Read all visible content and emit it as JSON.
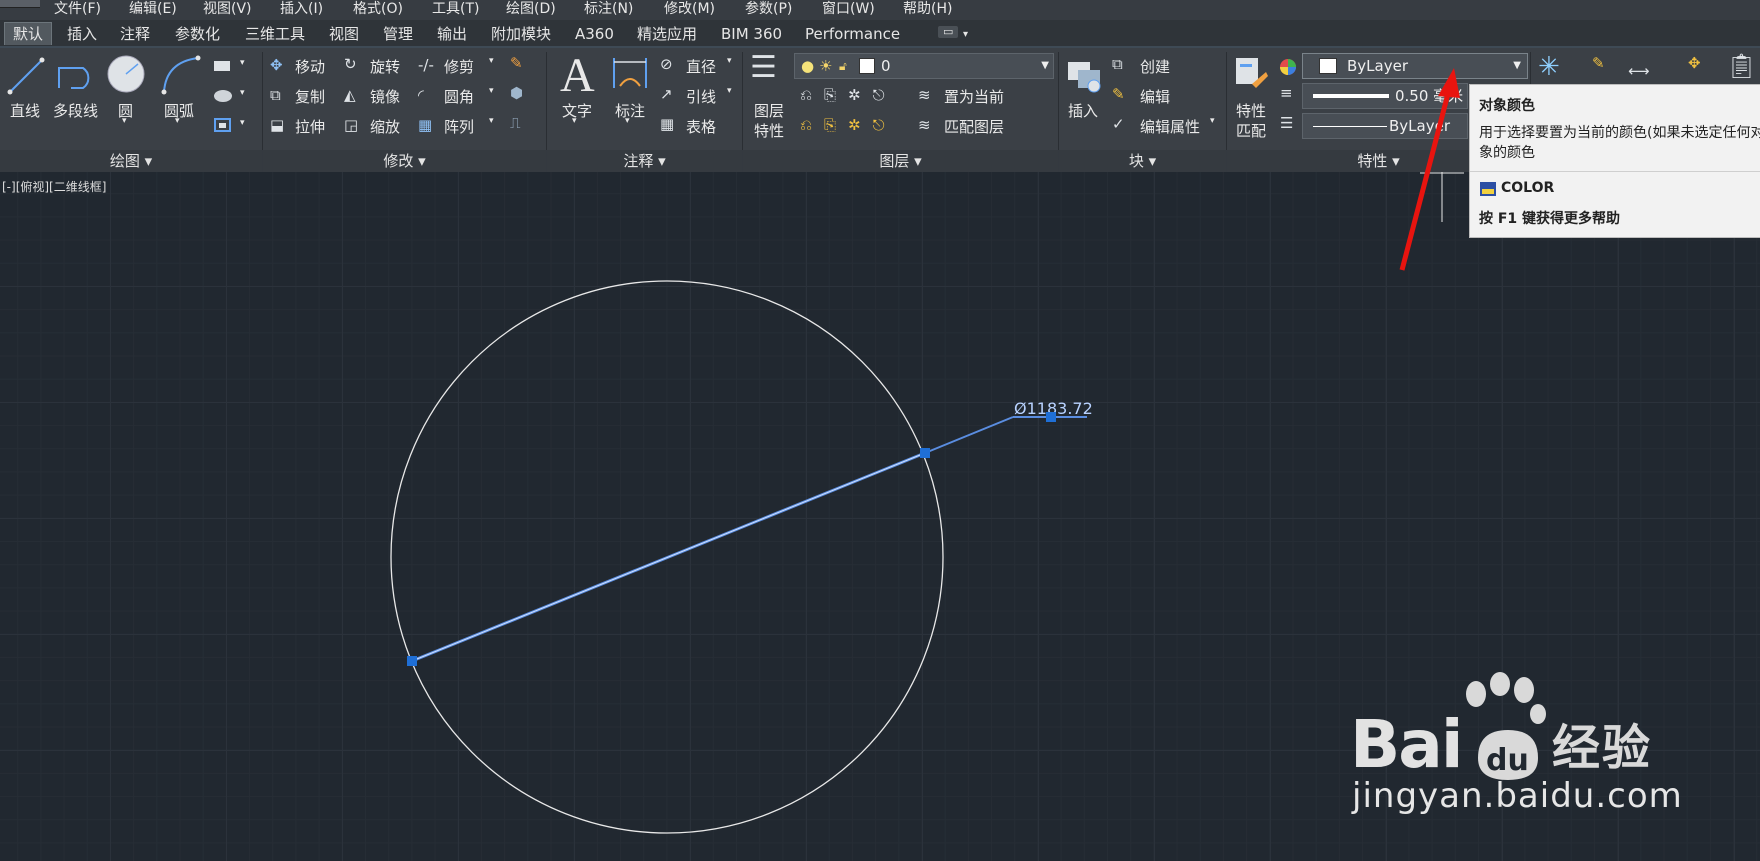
{
  "menu": [
    "文件(F)",
    "编辑(E)",
    "视图(V)",
    "插入(I)",
    "格式(O)",
    "工具(T)",
    "绘图(D)",
    "标注(N)",
    "修改(M)",
    "参数(P)",
    "窗口(W)",
    "帮助(H)"
  ],
  "tabs": [
    "默认",
    "插入",
    "注释",
    "参数化",
    "三维工具",
    "视图",
    "管理",
    "输出",
    "附加模块",
    "A360",
    "精选应用",
    "BIM 360",
    "Performance"
  ],
  "draw": {
    "line": "直线",
    "polyline": "多段线",
    "circle": "圆",
    "arc": "圆弧",
    "panel": "绘图"
  },
  "modify": {
    "move": "移动",
    "rotate": "旋转",
    "trim": "修剪",
    "copy": "复制",
    "mirror": "镜像",
    "fillet": "圆角",
    "stretch": "拉伸",
    "scale": "缩放",
    "array": "阵列",
    "panel": "修改"
  },
  "annotation": {
    "text": "文字",
    "dimension": "标注",
    "diameter": "直径",
    "leader": "引线",
    "table": "表格",
    "panel": "注释"
  },
  "layers": {
    "layer_props_1": "图层",
    "layer_props_2": "特性",
    "current_layer": "0",
    "set_current": "置为当前",
    "match_layer": "匹配图层",
    "panel": "图层"
  },
  "block": {
    "insert": "插入",
    "create": "创建",
    "edit": "编辑",
    "edit_attr": "编辑属性",
    "panel": "块"
  },
  "properties": {
    "match_1": "特性",
    "match_2": "匹配",
    "color": "ByLayer",
    "lineweight": "0.50 毫米",
    "linetype": "ByLayer",
    "panel": "特性"
  },
  "viewport": {
    "label": "[-][俯视][二维线框]",
    "dim_text": "Ø1183.72"
  },
  "tooltip": {
    "title": "对象颜色",
    "desc_1": "用于选择要置为当前的颜色(如果未选定任何对",
    "desc_2": "象的颜色",
    "command": "COLOR",
    "help": "按 F1 键获得更多帮助"
  },
  "watermark": {
    "cn": "经验",
    "url": "jingyan.baidu.com",
    "logo": "Bai"
  },
  "colors": {
    "selection": "#5a8de0",
    "grip": "#1f6fd6",
    "arrow": "#e8140f",
    "circle": "#e8e8e8"
  }
}
